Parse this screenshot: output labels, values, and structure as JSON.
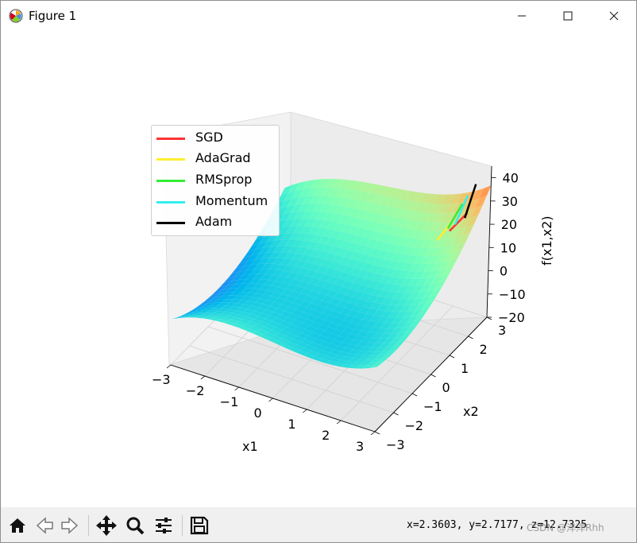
{
  "window": {
    "title": "Figure 1"
  },
  "legend": {
    "items": [
      {
        "label": "SGD",
        "color": "#ff3333"
      },
      {
        "label": "AdaGrad",
        "color": "#ffee33"
      },
      {
        "label": "RMSprop",
        "color": "#33ee33"
      },
      {
        "label": "Momentum",
        "color": "#33eeee"
      },
      {
        "label": "Adam",
        "color": "#000000"
      }
    ]
  },
  "chart_data": {
    "type": "surface3d",
    "title": "",
    "xlabel": "x1",
    "ylabel": "x2",
    "zlabel": "f(x1,x2)",
    "xlim": [
      -3,
      3
    ],
    "ylim": [
      -3,
      3
    ],
    "zlim": [
      -20,
      45
    ],
    "x_ticks": [
      "−3",
      "−2",
      "−1",
      "0",
      "1",
      "2",
      "3"
    ],
    "y_ticks": [
      "−3",
      "−2",
      "−1",
      "0",
      "1",
      "2",
      "3"
    ],
    "z_ticks": [
      "−20",
      "−10",
      "0",
      "10",
      "20",
      "30",
      "40"
    ],
    "colormap": "rainbow",
    "grid": true,
    "legend_position": "upper-left",
    "series": [
      {
        "name": "SGD",
        "color": "#ff3333"
      },
      {
        "name": "AdaGrad",
        "color": "#ffee33"
      },
      {
        "name": "RMSprop",
        "color": "#33ee33"
      },
      {
        "name": "Momentum",
        "color": "#33eeee"
      },
      {
        "name": "Adam",
        "color": "#000000"
      }
    ]
  },
  "toolbar": {
    "buttons": [
      "home-icon",
      "back-icon",
      "forward-icon",
      "pan-icon",
      "zoom-icon",
      "configure-subplots-icon",
      "save-icon"
    ],
    "coords": "x=2.3603, y=2.7177, z=12.7325"
  },
  "watermark": "CSDN @洋洋Rhh"
}
